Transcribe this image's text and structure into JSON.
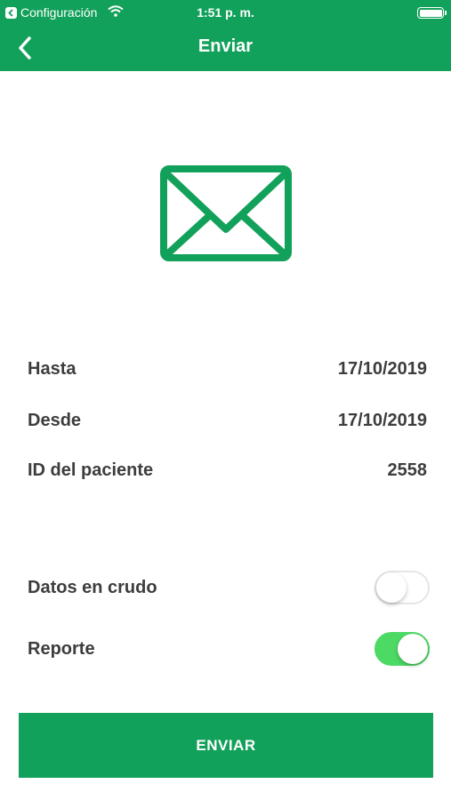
{
  "status_bar": {
    "back_app": "Configuración",
    "time": "1:51 p. m."
  },
  "nav": {
    "title": "Enviar"
  },
  "info": {
    "hasta_label": "Hasta",
    "hasta_value": "17/10/2019",
    "desde_label": "Desde",
    "desde_value": "17/10/2019",
    "patient_label": "ID del paciente",
    "patient_value": "2558"
  },
  "options": {
    "raw_label": "Datos en crudo",
    "raw_on": false,
    "report_label": "Reporte",
    "report_on": true
  },
  "send_button": "ENVIAR",
  "colors": {
    "brand": "#12a15a",
    "switch_on": "#4cd964"
  }
}
